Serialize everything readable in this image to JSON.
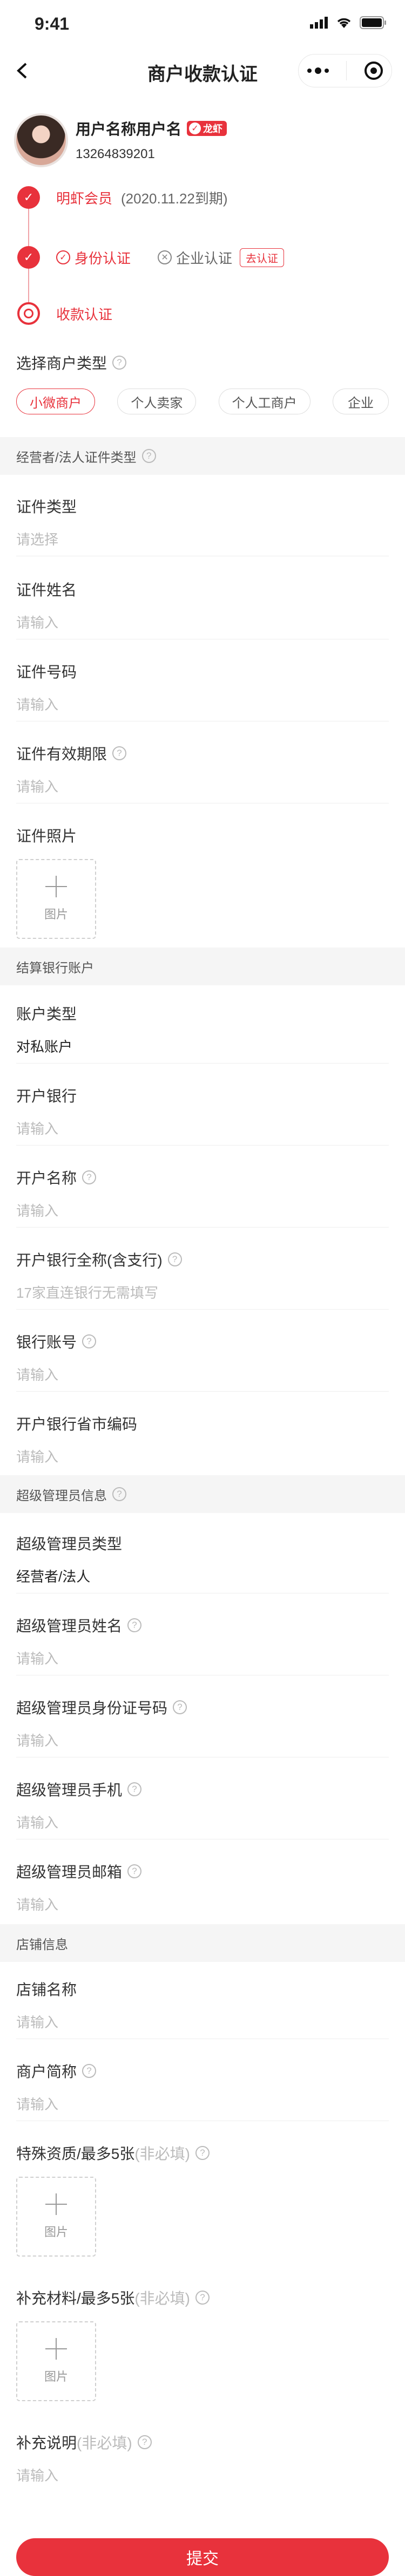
{
  "status_bar": {
    "time": "9:41"
  },
  "nav": {
    "title": "商户收款认证"
  },
  "profile": {
    "name": "用户名称用户名",
    "badge": "龙虾",
    "phone": "13264839201"
  },
  "steps": {
    "member": {
      "label": "明虾会员",
      "note": "(2020.11.22到期)"
    },
    "identity": {
      "personal": "身份认证",
      "enterprise": "企业认证",
      "go_auth": "去认证"
    },
    "payment": {
      "label": "收款认证"
    }
  },
  "merchant_type": {
    "label": "选择商户类型",
    "options": [
      "小微商户",
      "个人卖家",
      "个人工商户",
      "企业"
    ],
    "selected": "小微商户"
  },
  "sections": {
    "operator": "经营者/法人证件类型",
    "bank": "结算银行账户",
    "admin": "超级管理员信息",
    "shop": "店铺信息"
  },
  "operator_fields": {
    "cert_type": {
      "label": "证件类型",
      "placeholder": "请选择"
    },
    "cert_name": {
      "label": "证件姓名",
      "placeholder": "请输入"
    },
    "cert_no": {
      "label": "证件号码",
      "placeholder": "请输入"
    },
    "cert_valid": {
      "label": "证件有效期限",
      "placeholder": "请输入"
    },
    "cert_photo": {
      "label": "证件照片",
      "upload": "图片"
    }
  },
  "bank_fields": {
    "account_type": {
      "label": "账户类型",
      "value": "对私账户"
    },
    "bank": {
      "label": "开户银行",
      "placeholder": "请输入"
    },
    "account_name": {
      "label": "开户名称",
      "placeholder": "请输入"
    },
    "branch": {
      "label": "开户银行全称(含支行)",
      "placeholder": "17家直连银行无需填写"
    },
    "account_no": {
      "label": "银行账号",
      "placeholder": "请输入"
    },
    "city_code": {
      "label": "开户银行省市编码",
      "placeholder": "请输入"
    }
  },
  "admin_fields": {
    "type": {
      "label": "超级管理员类型",
      "value": "经营者/法人"
    },
    "name": {
      "label": "超级管理员姓名",
      "placeholder": "请输入"
    },
    "id_no": {
      "label": "超级管理员身份证号码",
      "placeholder": "请输入"
    },
    "mobile": {
      "label": "超级管理员手机",
      "placeholder": "请输入"
    },
    "email": {
      "label": "超级管理员邮箱",
      "placeholder": "请输入"
    }
  },
  "shop_fields": {
    "name": {
      "label": "店铺名称",
      "placeholder": "请输入"
    },
    "short_name": {
      "label": "商户简称",
      "placeholder": "请输入"
    },
    "special": {
      "label": "特殊资质/最多5张",
      "optional": "(非必填)",
      "upload": "图片"
    },
    "extra": {
      "label": "补充材料/最多5张",
      "optional": "(非必填)",
      "upload": "图片"
    },
    "note": {
      "label": "补充说明",
      "optional": "(非必填)",
      "placeholder": "请输入"
    }
  },
  "submit_label": "提交",
  "colors": {
    "accent": "#e8323c",
    "section_bg": "#f5f5f5",
    "placeholder": "#bbbbbb"
  }
}
